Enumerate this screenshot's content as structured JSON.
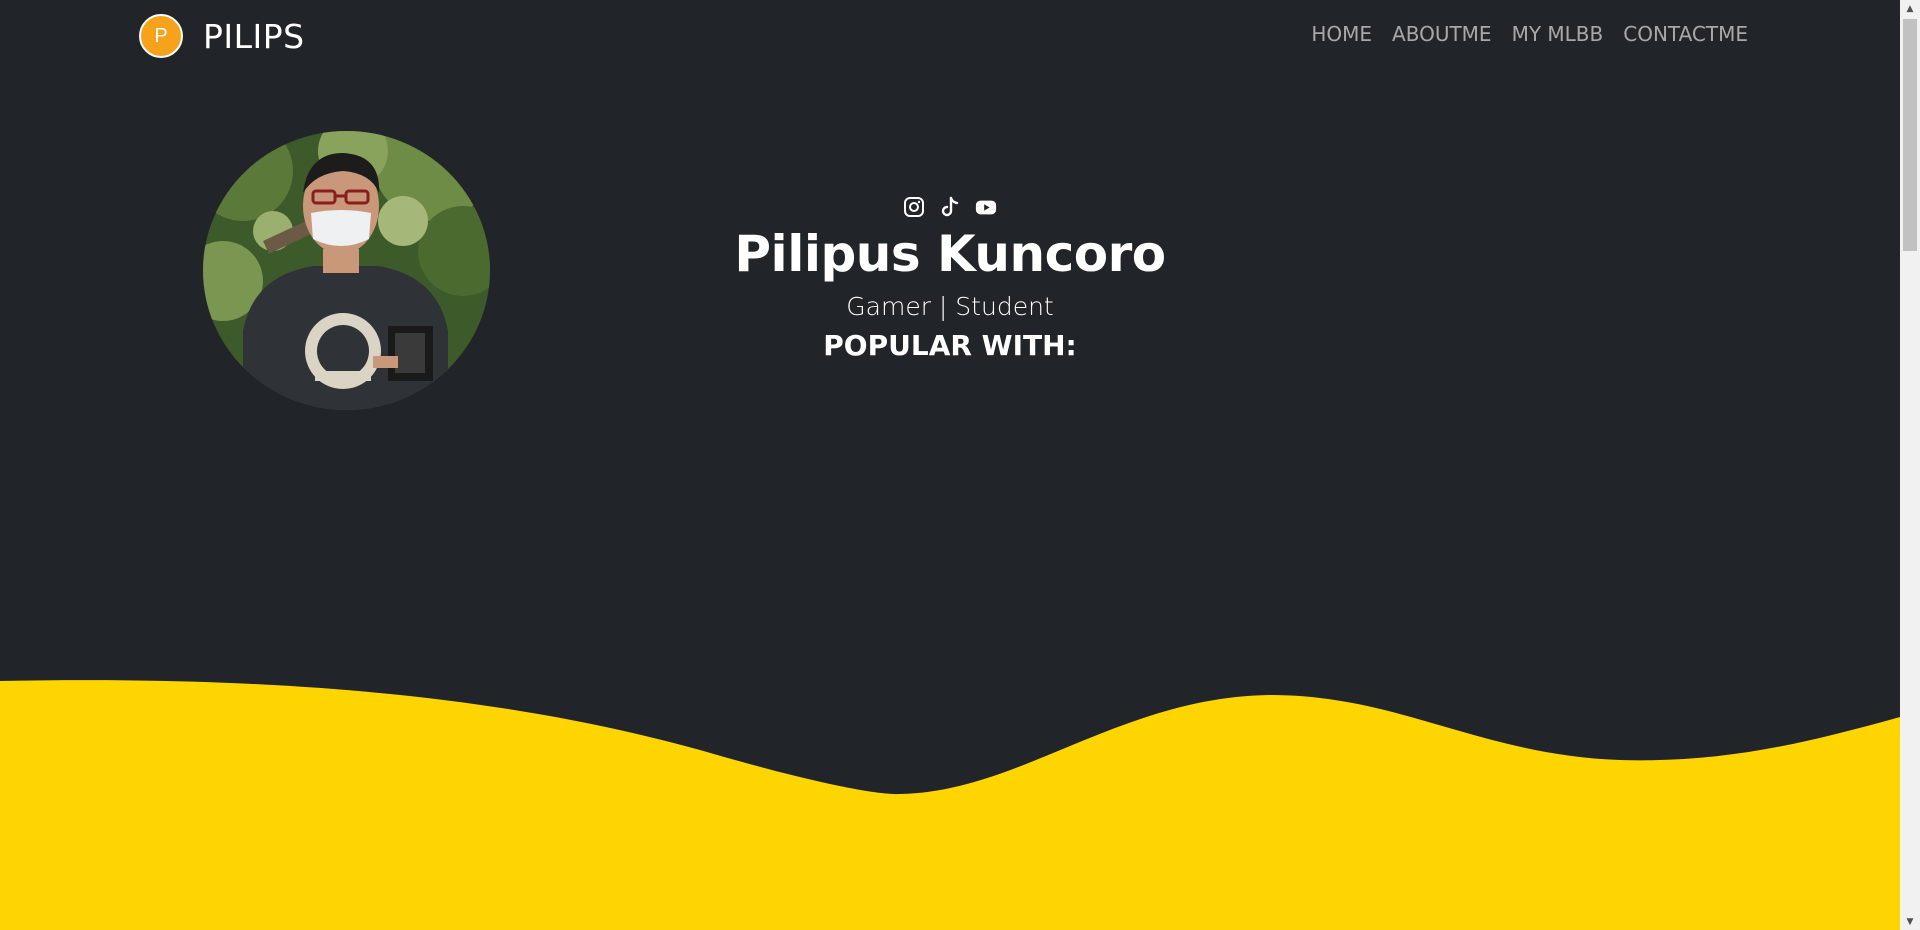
{
  "navbar": {
    "brand_initial": "P",
    "brand_name": "PILIPS",
    "links": [
      "HOME",
      "ABOUTME",
      "MY MLBB",
      "CONTACTME"
    ]
  },
  "profile": {
    "avatar_alt": "Profile photo"
  },
  "hero": {
    "socials": [
      "instagram-icon",
      "tiktok-icon",
      "youtube-icon"
    ],
    "name": "Pilipus Kuncoro",
    "role": "Gamer | Student",
    "popular_heading": "POPULAR WITH:"
  },
  "colors": {
    "background": "#212529",
    "accent_wave": "#ffd500",
    "brand_logo": "#f7a21b",
    "text": "#ffffff",
    "nav_text": "rgba(255,255,255,0.6)"
  },
  "scrollbar": {
    "up_arrow": "▲",
    "down_arrow": "▼"
  }
}
